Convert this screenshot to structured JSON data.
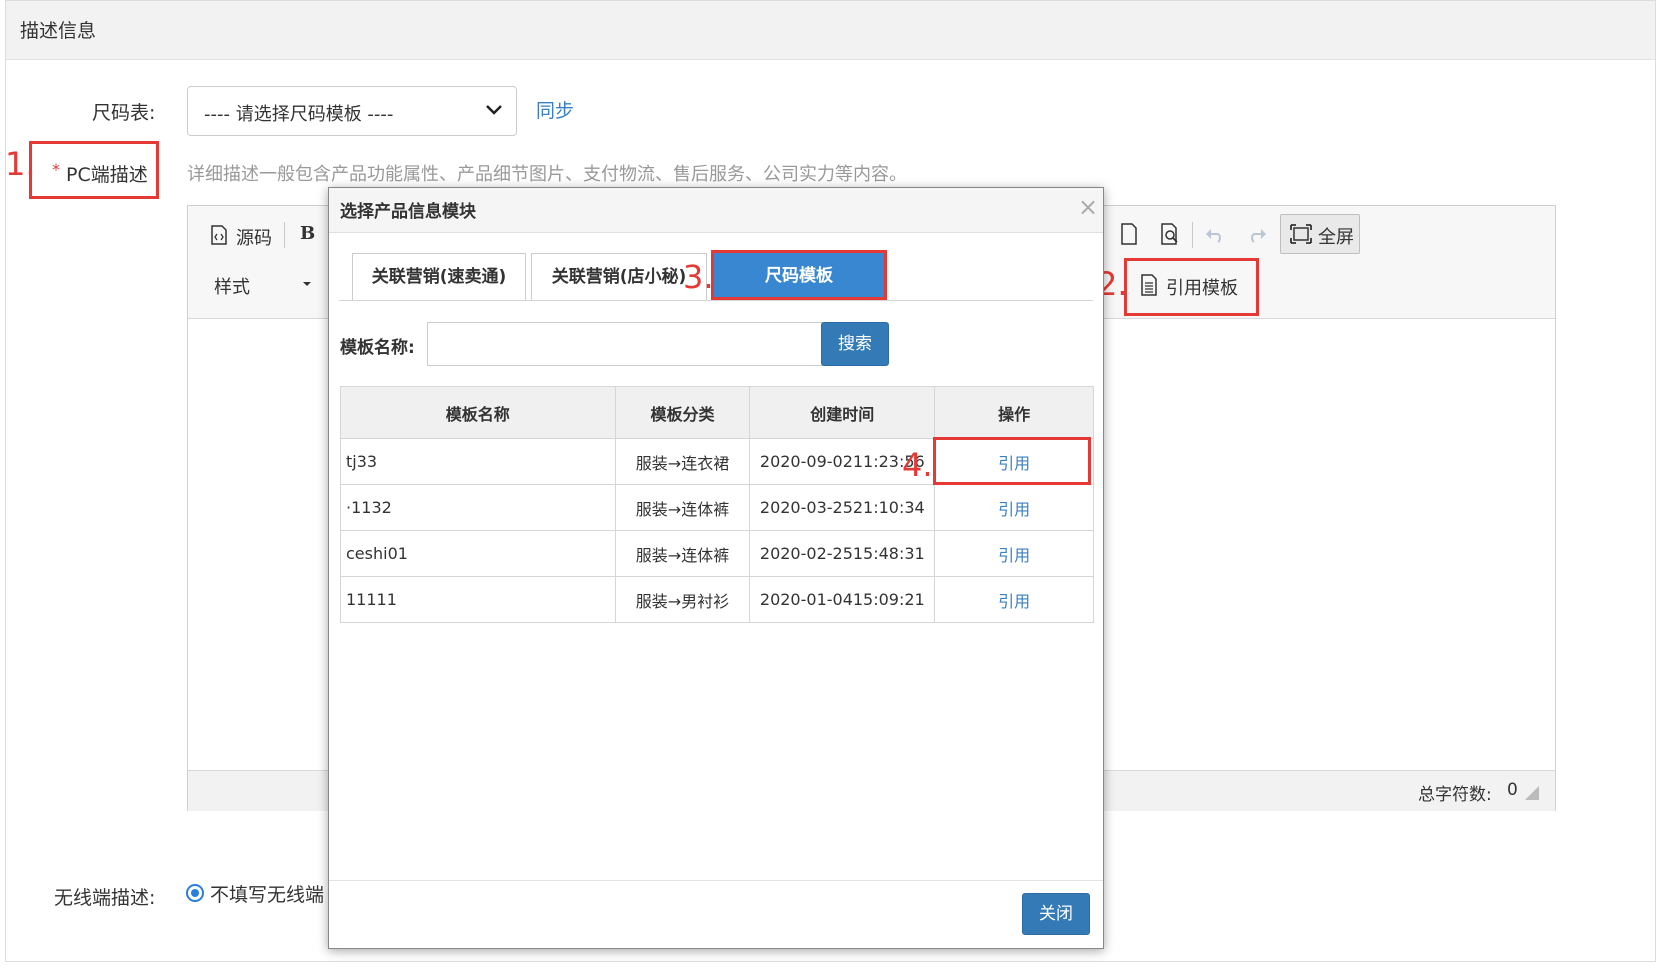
{
  "section": {
    "title": "描述信息"
  },
  "size_chart": {
    "label": "尺码表:",
    "selected": "---- 请选择尺码模板 ----",
    "sync": "同步"
  },
  "pc_desc": {
    "required": "*",
    "label": "PC端描述",
    "hint": "详细描述一般包含产品功能属性、产品细节图片、支付物流、售后服务、公司实力等内容。"
  },
  "editor": {
    "source": "源码",
    "bold": "B",
    "style": "样式",
    "fullscreen": "全屏",
    "cite_template": "引用模板",
    "word_count_label": "总字符数:",
    "word_count": "0"
  },
  "wireless": {
    "label": "无线端描述:",
    "option": "不填写无线端"
  },
  "markers": [
    "1.",
    "2.",
    "3.",
    "4."
  ],
  "modal": {
    "title": "选择产品信息模块",
    "close_x": "×",
    "tabs": [
      "关联营销(速卖通)",
      "关联营销(店小秘)",
      "尺码模板"
    ],
    "search_label": "模板名称:",
    "search_value": "",
    "search_button": "搜索",
    "columns": [
      "模板名称",
      "模板分类",
      "创建时间",
      "操作"
    ],
    "rows": [
      {
        "name": "tj33",
        "category": "服装→连衣裙",
        "time": "2020-09-0211:23:56",
        "action": "引用"
      },
      {
        "name": "·1132",
        "category": "服装→连体裤",
        "time": "2020-03-2521:10:34",
        "action": "引用"
      },
      {
        "name": "ceshi01",
        "category": "服装→连体裤",
        "time": "2020-02-2515:48:31",
        "action": "引用"
      },
      {
        "name": "11111",
        "category": "服装→男衬衫",
        "time": "2020-01-0415:09:21",
        "action": "引用"
      }
    ],
    "close_button": "关闭"
  },
  "colors": {
    "accent": "#3a87d1",
    "link": "#3a7fc4",
    "annotation": "#e53935"
  }
}
